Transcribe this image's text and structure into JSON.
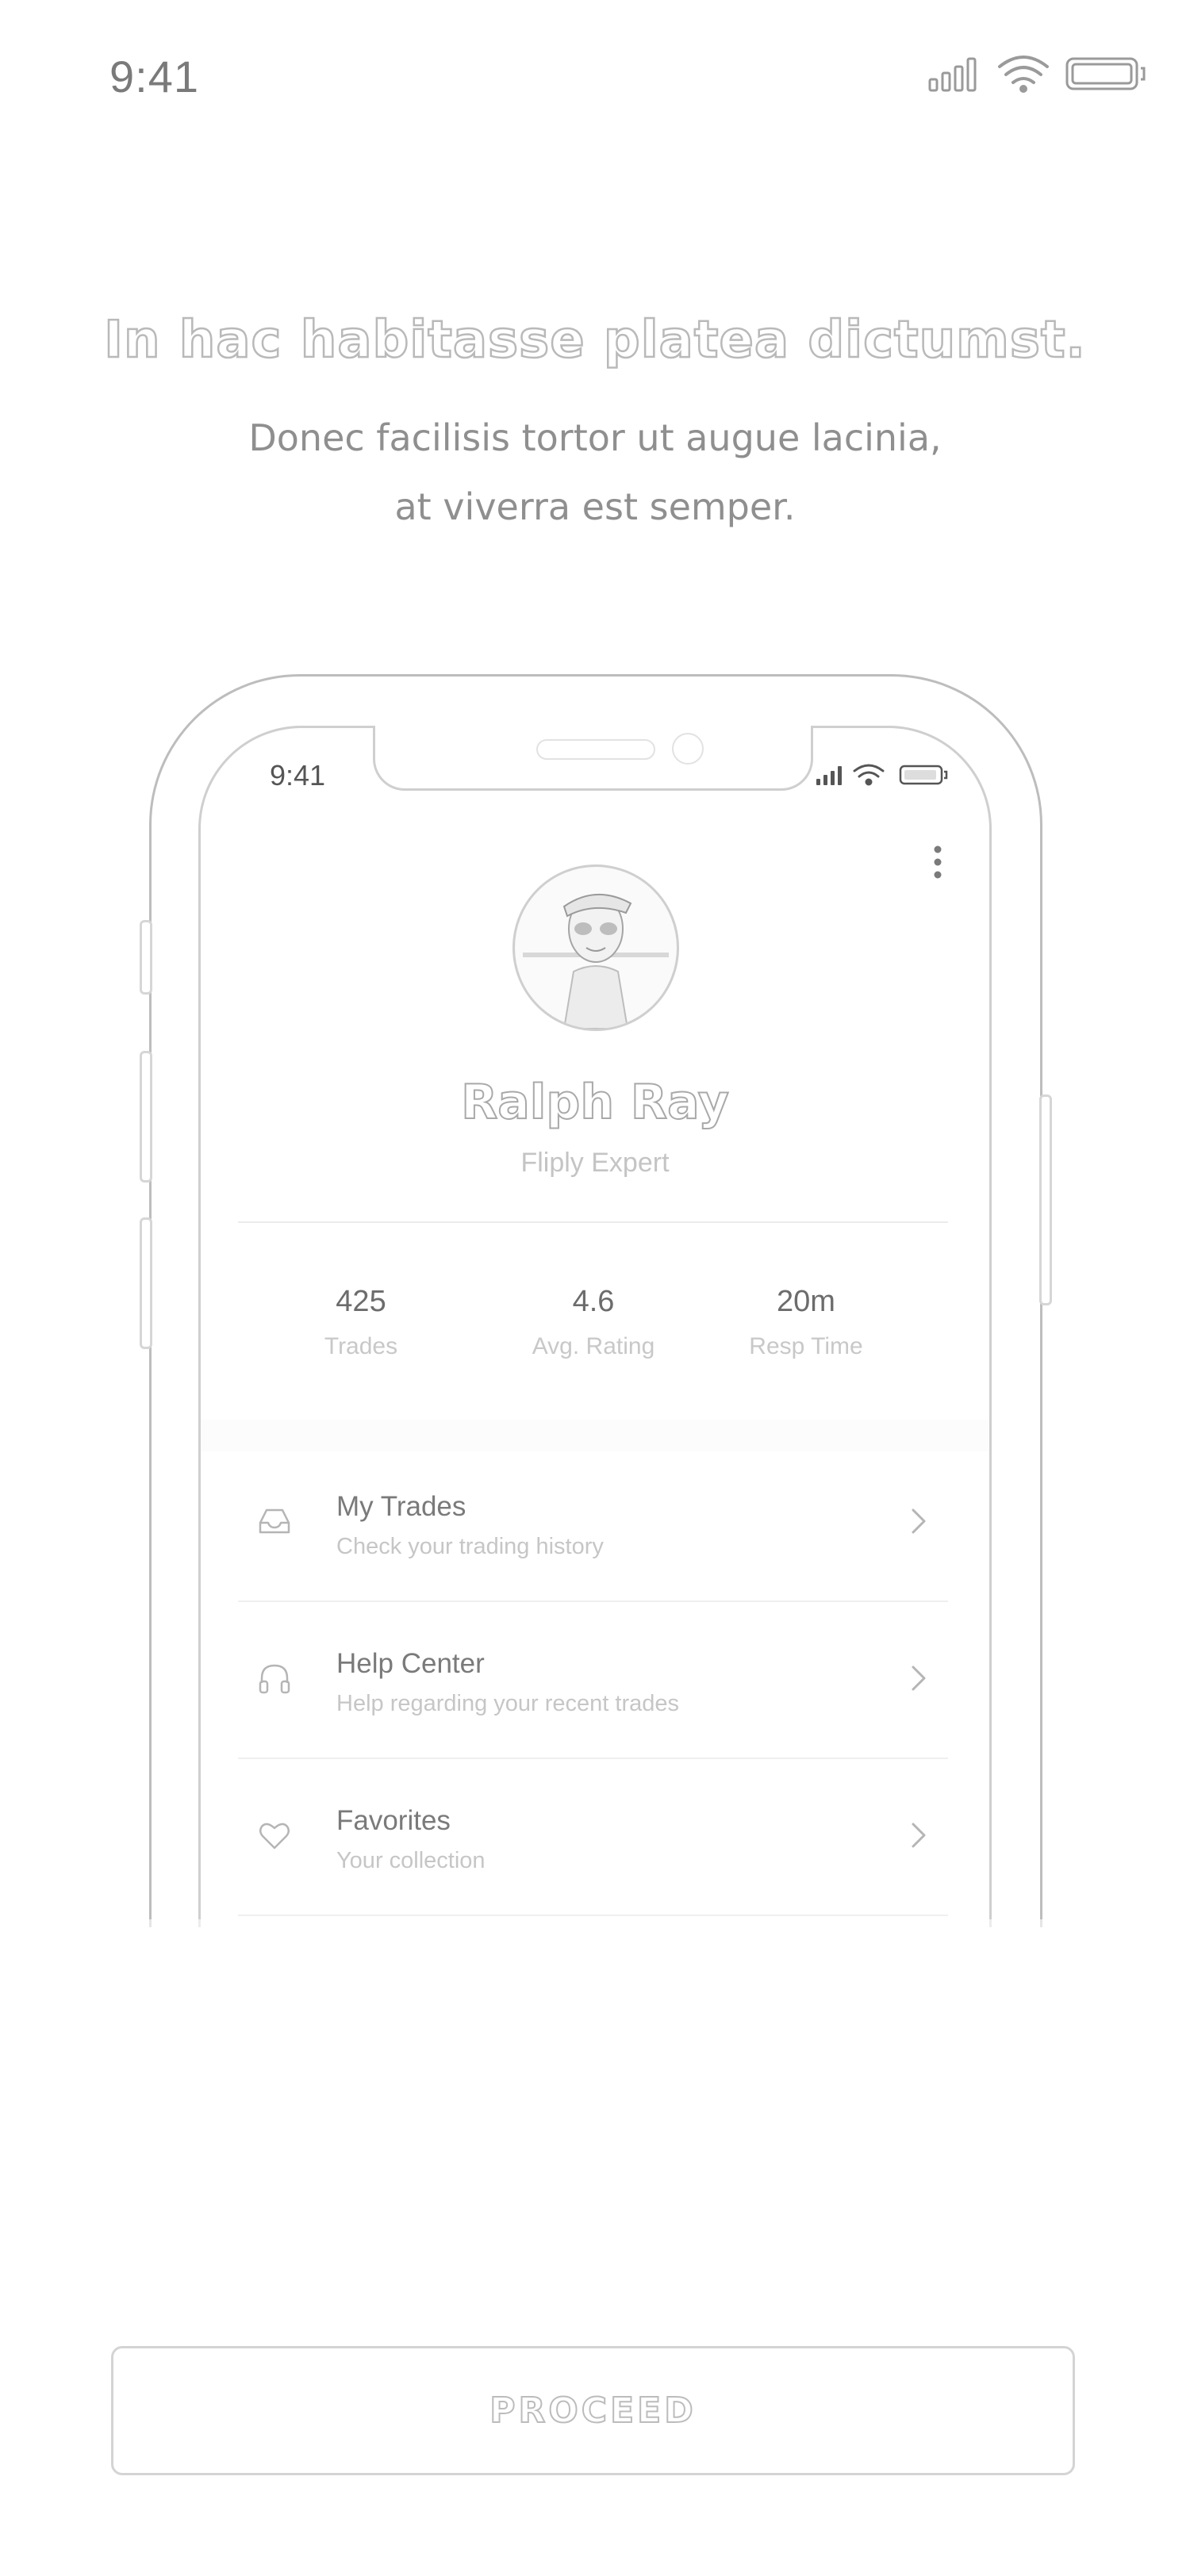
{
  "status_bar": {
    "time": "9:41"
  },
  "intro": {
    "headline": "In hac habitasse platea dictumst.",
    "subtitle_line1": "Donec facilisis tortor ut augue lacinia,",
    "subtitle_line2": "at viverra est semper."
  },
  "device_preview": {
    "status_time": "9:41",
    "profile": {
      "name": "Ralph Ray",
      "role": "Fliply Expert"
    },
    "stats": [
      {
        "value": "425",
        "label": "Trades"
      },
      {
        "value": "4.6",
        "label": "Avg. Rating"
      },
      {
        "value": "20m",
        "label": "Resp Time"
      }
    ],
    "menu": [
      {
        "icon": "inbox-icon",
        "title": "My Trades",
        "subtitle": "Check your trading history"
      },
      {
        "icon": "headphones-icon",
        "title": "Help Center",
        "subtitle": "Help regarding your recent trades"
      },
      {
        "icon": "heart-icon",
        "title": "Favorites",
        "subtitle": "Your collection"
      }
    ]
  },
  "actions": {
    "proceed_label": "PROCEED"
  },
  "colors": {
    "text_gray": "#8f8f8f",
    "stroke_gray": "#bcbcbc",
    "background": "#ffffff"
  }
}
